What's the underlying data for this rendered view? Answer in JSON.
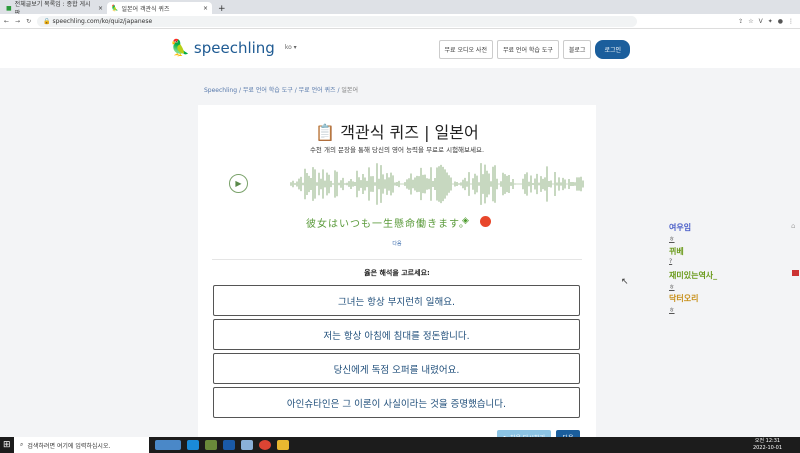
{
  "browser": {
    "tabs": [
      {
        "title": "전체글보기 목록임 : 종합 게시판",
        "close": "×"
      },
      {
        "title": "일본어 객관식 퀴즈",
        "close": "×"
      }
    ],
    "new_tab": "+",
    "url": "speechling.com/ko/quiz/japanese"
  },
  "site": {
    "logo": "speechling",
    "lang": "ko ▾",
    "nav": [
      "무료 오디오 사전",
      "무료 언어 학습 도구",
      "블로그"
    ],
    "login": "로그인"
  },
  "breadcrumb": [
    "Speechling",
    "무료 언어 학습 도구",
    "무료 언어 퀴즈",
    "일본어"
  ],
  "quiz": {
    "icon": "📋",
    "title": "객관식 퀴즈 | 일본어",
    "subtitle": "수천 개의 문장을 통해 당신의 영어 능력을 무료로 시험해보세요.",
    "sentence": "彼女はいつも一生懸命働きます。",
    "next_small": "다음",
    "prompt": "옳은 해석을 고르세요:",
    "options": [
      "그녀는 항상 부지런히 일해요.",
      "저는 항상 아침에 침대를 정돈합니다.",
      "당신에게 독점 오퍼를 내렸어요.",
      "아인슈타인은 그 이론이 사실이라는 것을 증명했습니다."
    ],
    "restart": "↻ 처음 다시하기",
    "next": "다음"
  },
  "sidebar": [
    {
      "name": "여우임",
      "sub": "ㅎ",
      "color": "#4a5ec8"
    },
    {
      "name": "뀌베",
      "sub": "?",
      "color": "#6a9a1a"
    },
    {
      "name": "재미있는역사_",
      "sub": "ㅎ",
      "color": "#6a9a1a"
    },
    {
      "name": "닥터오리",
      "sub": "ㅎ",
      "color": "#c8901a"
    }
  ],
  "taskbar": {
    "search": "검색하려면 여기에 입력하십시오.",
    "time": "오전 12:31",
    "date": "2022-10-01"
  }
}
